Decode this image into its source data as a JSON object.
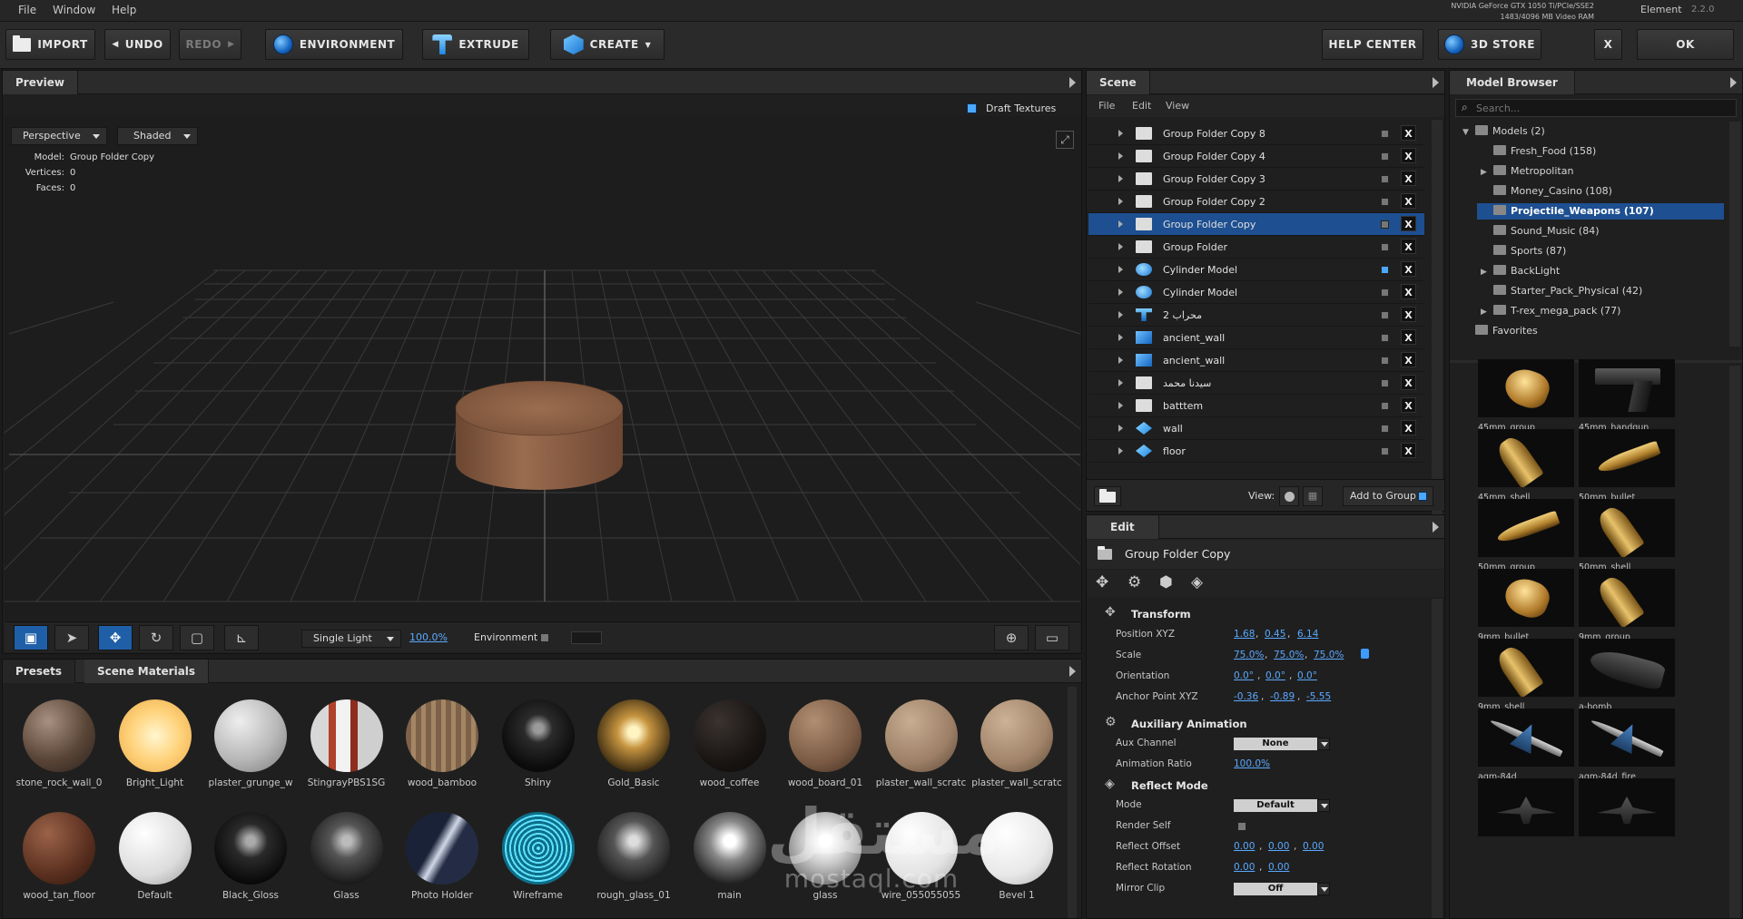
{
  "menubar": {
    "items": [
      "File",
      "Window",
      "Help"
    ],
    "gpu_line1": "NVIDIA GeForce GTX 1050 Ti/PCIe/SSE2",
    "gpu_line2": "1483/4096 MB Video RAM",
    "app_name": "Element",
    "app_version": "2.2.0"
  },
  "toolbar": {
    "import": "IMPORT",
    "undo": "UNDO",
    "redo": "REDO",
    "environment": "ENVIRONMENT",
    "extrude": "EXTRUDE",
    "create": "CREATE",
    "help_center": "HELP CENTER",
    "store": "3D STORE",
    "close": "X",
    "ok": "OK"
  },
  "preview": {
    "tab": "Preview",
    "draft_textures": "Draft Textures",
    "camera_mode": "Perspective",
    "shading_mode": "Shaded",
    "model_label": "Model:",
    "model_value": "Group Folder Copy",
    "vertices_label": "Vertices:",
    "vertices_value": "0",
    "faces_label": "Faces:",
    "faces_value": "0",
    "light_mode": "Single Light",
    "light_value": "100.0%",
    "environment_label": "Environment"
  },
  "materials": {
    "tabs": [
      "Presets",
      "Scene Materials"
    ],
    "row1": [
      {
        "name": "stone_rock_wall_0"
      },
      {
        "name": "Bright_Light"
      },
      {
        "name": "plaster_grunge_w"
      },
      {
        "name": "StingrayPBS1SG"
      },
      {
        "name": "wood_bamboo"
      },
      {
        "name": "Shiny"
      },
      {
        "name": "Gold_Basic"
      },
      {
        "name": "wood_coffee"
      },
      {
        "name": "wood_board_01"
      },
      {
        "name": "plaster_wall_scratc"
      },
      {
        "name": "plaster_wall_scratc"
      }
    ],
    "row2": [
      {
        "name": "wood_tan_floor"
      },
      {
        "name": "Default"
      },
      {
        "name": "Black_Gloss"
      },
      {
        "name": "Glass"
      },
      {
        "name": "Photo Holder"
      },
      {
        "name": "Wireframe"
      },
      {
        "name": "rough_glass_01"
      },
      {
        "name": "main"
      },
      {
        "name": "glass"
      },
      {
        "name": "wire_055055055"
      },
      {
        "name": "Bevel 1"
      }
    ]
  },
  "scene": {
    "tab": "Scene",
    "menu": [
      "File",
      "Edit",
      "View"
    ],
    "items": [
      {
        "name": "Group Folder Copy 8",
        "icon": "folder-icon",
        "selected": false,
        "visible_on": false
      },
      {
        "name": "Group Folder Copy 4",
        "icon": "folder-icon",
        "selected": false,
        "visible_on": false
      },
      {
        "name": "Group Folder Copy 3",
        "icon": "folder-icon",
        "selected": false,
        "visible_on": false
      },
      {
        "name": "Group Folder Copy 2",
        "icon": "folder-icon",
        "selected": false,
        "visible_on": false
      },
      {
        "name": "Group Folder Copy",
        "icon": "folder-icon",
        "selected": true,
        "visible_on": false
      },
      {
        "name": "Group Folder",
        "icon": "folder-icon",
        "selected": false,
        "visible_on": false
      },
      {
        "name": "Cylinder Model",
        "icon": "cylinder-icon",
        "selected": false,
        "visible_on": true
      },
      {
        "name": "Cylinder Model",
        "icon": "cylinder-icon",
        "selected": false,
        "visible_on": false
      },
      {
        "name": "محراب 2",
        "icon": "text-model-icon",
        "selected": false,
        "visible_on": false
      },
      {
        "name": "ancient_wall",
        "icon": "box-icon",
        "selected": false,
        "visible_on": false
      },
      {
        "name": "ancient_wall",
        "icon": "box-icon",
        "selected": false,
        "visible_on": false
      },
      {
        "name": "سيدنا محمد",
        "icon": "folder-icon",
        "selected": false,
        "visible_on": false
      },
      {
        "name": "batttem",
        "icon": "folder-icon",
        "selected": false,
        "visible_on": false
      },
      {
        "name": "wall",
        "icon": "plane-icon",
        "selected": false,
        "visible_on": false
      },
      {
        "name": "floor",
        "icon": "plane-icon",
        "selected": false,
        "visible_on": false
      }
    ],
    "remove_label": "X",
    "view_label": "View:",
    "add_to_group": "Add to Group"
  },
  "edit": {
    "tab": "Edit",
    "object_name": "Group Folder Copy",
    "transform_title": "Transform",
    "position_label": "Position XYZ",
    "position": [
      "1.68",
      "0.45",
      "6.14"
    ],
    "scale_label": "Scale",
    "scale": [
      "75.0%",
      "75.0%",
      "75.0%"
    ],
    "orientation_label": "Orientation",
    "orientation": [
      "0.0°",
      "0.0°",
      "0.0°"
    ],
    "anchor_label": "Anchor Point XYZ",
    "anchor": [
      "-0.36",
      "-0.89",
      "-5.55"
    ],
    "aux_title": "Auxiliary Animation",
    "aux_channel_label": "Aux Channel",
    "aux_channel_value": "None",
    "anim_ratio_label": "Animation Ratio",
    "anim_ratio_value": "100.0%",
    "reflect_title": "Reflect Mode",
    "mode_label": "Mode",
    "mode_value": "Default",
    "render_self_label": "Render Self",
    "reflect_offset_label": "Reflect Offset",
    "reflect_offset": [
      "0.00",
      "0.00",
      "0.00"
    ],
    "reflect_rotation_label": "Reflect Rotation",
    "reflect_rotation": [
      "0.00",
      "0.00"
    ],
    "mirror_clip_label": "Mirror Clip",
    "mirror_clip_value": "Off"
  },
  "model_browser": {
    "tab": "Model Browser",
    "search_placeholder": "Search...",
    "tree": [
      {
        "label": "Models (2)",
        "level": 0,
        "expand": "open",
        "selected": false
      },
      {
        "label": "Fresh_Food (158)",
        "level": 1,
        "expand": "none",
        "selected": false
      },
      {
        "label": "Metropolitan",
        "level": 1,
        "expand": "closed",
        "selected": false
      },
      {
        "label": "Money_Casino (108)",
        "level": 1,
        "expand": "none",
        "selected": false
      },
      {
        "label": "Projectile_Weapons (107)",
        "level": 1,
        "expand": "none",
        "selected": true
      },
      {
        "label": "Sound_Music (84)",
        "level": 1,
        "expand": "none",
        "selected": false
      },
      {
        "label": "Sports (87)",
        "level": 1,
        "expand": "none",
        "selected": false
      },
      {
        "label": "BackLight",
        "level": 1,
        "expand": "closed",
        "selected": false
      },
      {
        "label": "Starter_Pack_Physical (42)",
        "level": 1,
        "expand": "none",
        "selected": false
      },
      {
        "label": "T-rex_mega_pack (77)",
        "level": 1,
        "expand": "closed",
        "selected": false
      },
      {
        "label": "Favorites",
        "level": 0,
        "expand": "none",
        "selected": false
      }
    ],
    "thumbs": [
      {
        "name": "45mm_group",
        "kind": "bullet"
      },
      {
        "name": "45mm_handgun",
        "kind": "gun"
      },
      {
        "name": "45mm_shell",
        "kind": "shell"
      },
      {
        "name": "50mm_bullet",
        "kind": "bullet-long"
      },
      {
        "name": "50mm_group",
        "kind": "bullet-long"
      },
      {
        "name": "50mm_shell",
        "kind": "shell"
      },
      {
        "name": "9mm_bullet",
        "kind": "bullet"
      },
      {
        "name": "9mm_group",
        "kind": "shell"
      },
      {
        "name": "9mm_shell",
        "kind": "shell"
      },
      {
        "name": "a-bomb",
        "kind": "bomb"
      },
      {
        "name": "agm-84d",
        "kind": "missile"
      },
      {
        "name": "agm-84d_fire",
        "kind": "missile"
      },
      {
        "name": "",
        "kind": "jet"
      },
      {
        "name": "",
        "kind": "jet"
      }
    ]
  },
  "watermark": {
    "arabic": "مستقل",
    "latin": "mostaql.com"
  },
  "colors": {
    "accent": "#1d4f91",
    "link": "#5aa9ff",
    "panel_bg": "#1f1f1f"
  }
}
